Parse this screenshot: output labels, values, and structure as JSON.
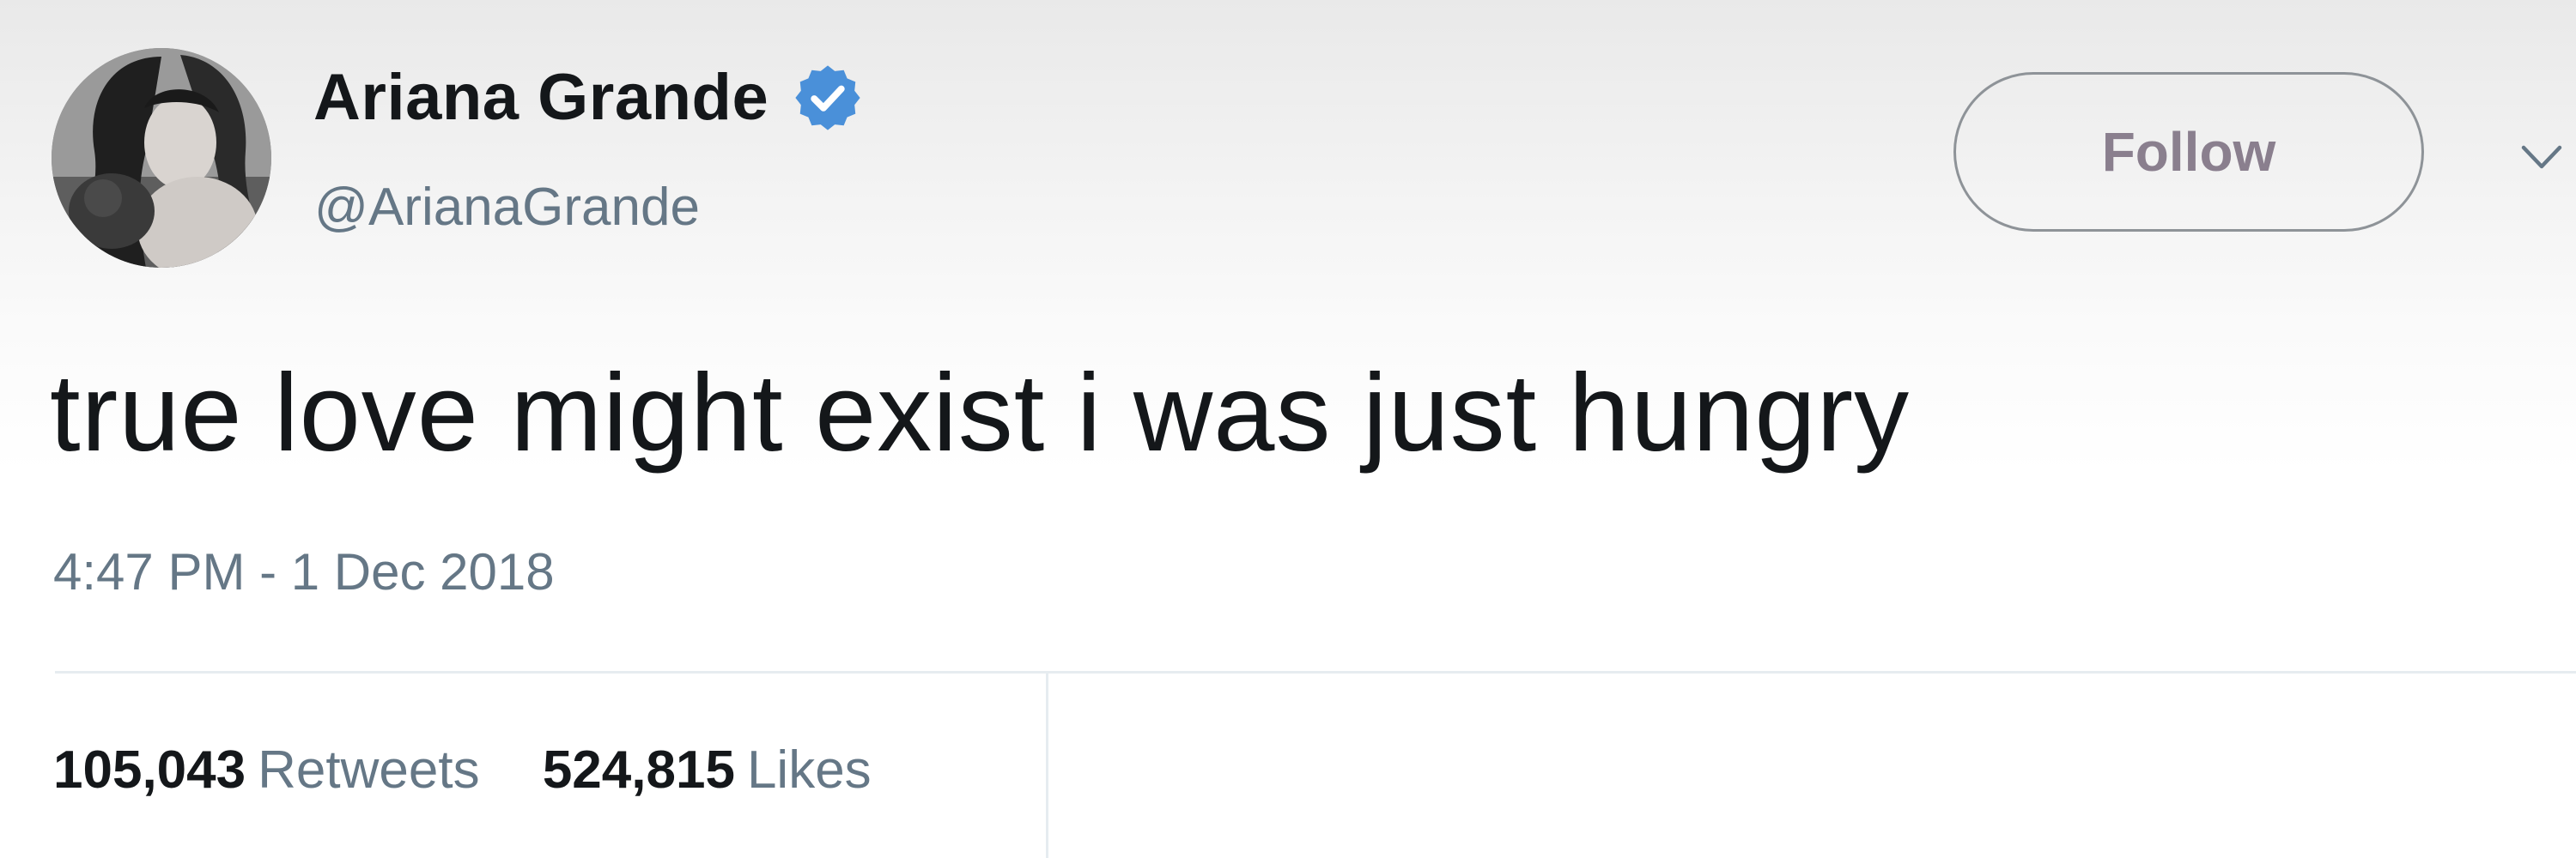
{
  "user": {
    "display_name": "Ariana Grande",
    "handle": "@ArianaGrande",
    "verified": true
  },
  "follow_button": {
    "label": "Follow"
  },
  "tweet": {
    "text": "true love might exist i was just hungry",
    "timestamp": "4:47 PM - 1 Dec 2018"
  },
  "stats": {
    "retweets": {
      "count": "105,043",
      "label": "Retweets"
    },
    "likes": {
      "count": "524,815",
      "label": "Likes"
    }
  },
  "icons": {
    "verified": "verified-badge-icon",
    "menu": "chevron-down-icon"
  },
  "colors": {
    "verified_blue": "#4a90d9",
    "secondary_text": "#657786",
    "primary_text": "#14171a"
  }
}
